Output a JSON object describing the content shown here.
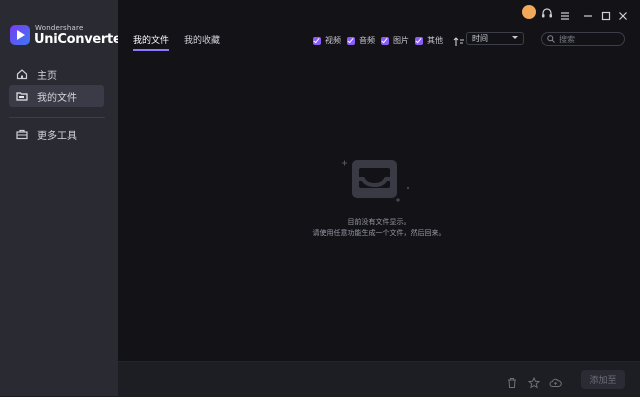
{
  "brand": {
    "small": "Wondershare",
    "name": "UniConverter",
    "accent": "#8b5cf6"
  },
  "sidebar": {
    "items": [
      {
        "label": "主页",
        "icon": "home-icon"
      },
      {
        "label": "我的文件",
        "icon": "folder-icon",
        "active": true
      },
      {
        "label": "更多工具",
        "icon": "toolbox-icon"
      }
    ]
  },
  "tabs": [
    {
      "label": "我的文件",
      "active": true
    },
    {
      "label": "我的收藏"
    }
  ],
  "filters": [
    {
      "label": "视频",
      "checked": true
    },
    {
      "label": "音频",
      "checked": true
    },
    {
      "label": "图片",
      "checked": true
    },
    {
      "label": "其他",
      "checked": true
    }
  ],
  "sort": {
    "icon": "sort-icon",
    "selected": "时间"
  },
  "search": {
    "placeholder": "搜索",
    "icon": "search-icon"
  },
  "titlebar": {
    "icons": [
      "avatar",
      "headset-icon",
      "menu-icon",
      "minimize-icon",
      "maximize-icon",
      "close-icon"
    ]
  },
  "empty_state": {
    "icon": "inbox-icon",
    "line1": "目前没有文件显示。",
    "line2": "请使用任意功能生成一个文件，然后回来。"
  },
  "bottom": {
    "icons": [
      "trash-icon",
      "star-icon",
      "cloud-icon"
    ],
    "add_label": "添加至"
  }
}
